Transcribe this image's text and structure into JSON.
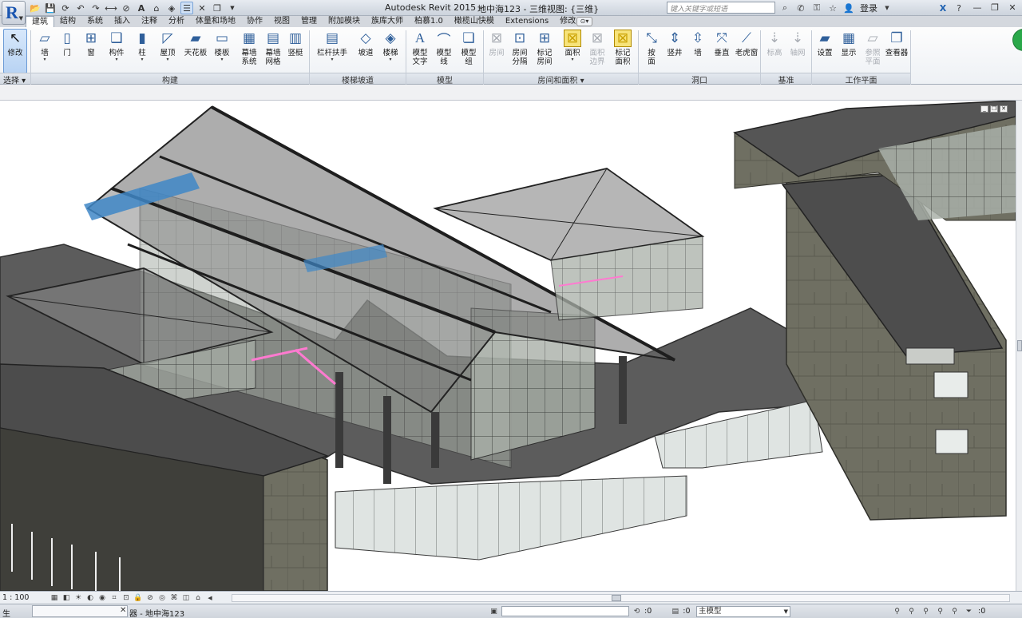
{
  "app": {
    "title": "Autodesk Revit 2015 -",
    "document": "地中海123 - 三维视图: {三维}",
    "search_placeholder": "键入关键字或短语",
    "login": "登录"
  },
  "qat_icons": [
    "open-icon",
    "save-icon",
    "sync-icon",
    "undo-icon",
    "redo-icon",
    "measure-icon",
    "tag-icon",
    "text-icon",
    "default-3d-icon",
    "section-icon",
    "thin-lines-icon",
    "close-windows-icon",
    "switch-windows-icon"
  ],
  "tabs": [
    {
      "label": "建筑",
      "active": true
    },
    {
      "label": "结构"
    },
    {
      "label": "系统"
    },
    {
      "label": "插入"
    },
    {
      "label": "注释"
    },
    {
      "label": "分析"
    },
    {
      "label": "体量和场地"
    },
    {
      "label": "协作"
    },
    {
      "label": "视图"
    },
    {
      "label": "管理"
    },
    {
      "label": "附加模块"
    },
    {
      "label": "族库大师"
    },
    {
      "label": "柏慕1.0"
    },
    {
      "label": "橄榄山快模"
    },
    {
      "label": "Extensions"
    },
    {
      "label": "修改"
    }
  ],
  "ribbon": {
    "modify": "修改",
    "select": "选择",
    "build": {
      "label": "构建",
      "items": [
        "墙",
        "门",
        "窗",
        "构件",
        "柱",
        "屋顶",
        "天花板",
        "楼板",
        "幕墙\n系统",
        "幕墙\n网格",
        "竖梃"
      ]
    },
    "stair": {
      "label": "楼梯坡道",
      "items": [
        "栏杆扶手",
        "坡道",
        "楼梯"
      ]
    },
    "model": {
      "label": "模型",
      "items": [
        "模型\n文字",
        "模型\n线",
        "模型\n组"
      ]
    },
    "room": {
      "label": "房间和面积",
      "items": [
        "房间",
        "房间\n分隔",
        "标记\n房间",
        "面积",
        "面积\n边界",
        "标记\n面积"
      ]
    },
    "opening": {
      "label": "洞口",
      "items": [
        "按\n面",
        "竖井",
        "墙",
        "垂直",
        "老虎窗"
      ]
    },
    "datum": {
      "label": "基准",
      "items": [
        "标高",
        "轴网"
      ]
    },
    "workplane": {
      "label": "工作平面",
      "items": [
        "设置",
        "显示",
        "参照\n平面",
        "查看器"
      ]
    }
  },
  "viewbar": {
    "scale": "1 : 100"
  },
  "statusbar": {
    "left": "生",
    "browser": "器 - 地中海123",
    "zero1": ":0",
    "zero2": ":0",
    "model": "主模型"
  }
}
